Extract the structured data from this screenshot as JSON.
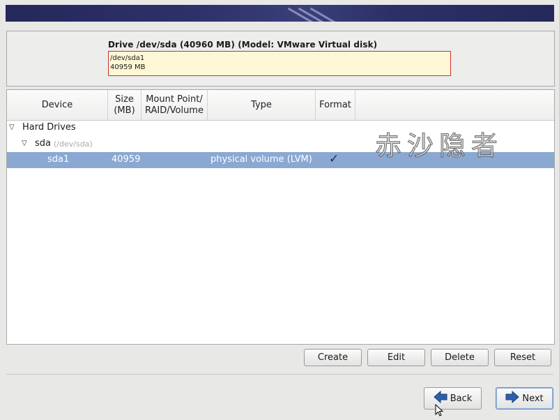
{
  "drive": {
    "title": "Drive /dev/sda (40960 MB) (Model: VMware Virtual disk)",
    "partition_name": "/dev/sda1",
    "partition_size": "40959 MB"
  },
  "columns": {
    "device": "Device",
    "size": "Size\n(MB)",
    "mount": "Mount Point/\nRAID/Volume",
    "type": "Type",
    "format": "Format"
  },
  "tree": {
    "group": "Hard Drives",
    "disk": "sda",
    "disk_path": "(/dev/sda)",
    "partition": {
      "device": "sda1",
      "size": "40959",
      "mount": "",
      "type": "physical volume (LVM)",
      "format": "✓"
    }
  },
  "watermark": "赤沙隐者",
  "buttons": {
    "create": "Create",
    "edit": "Edit",
    "delete": "Delete",
    "reset": "Reset",
    "back": "Back",
    "next": "Next"
  },
  "icons": {
    "expander": "expander-triangle-icon",
    "back": "back-arrow-icon",
    "next": "next-arrow-icon",
    "check": "checkmark-icon"
  },
  "colors": {
    "selection": "#8aa8d2",
    "drive_bar_fill": "#fdf7d6",
    "drive_bar_border": "#c83232",
    "banner": "#2e3169",
    "arrow_blue": "#2f5fa8"
  }
}
